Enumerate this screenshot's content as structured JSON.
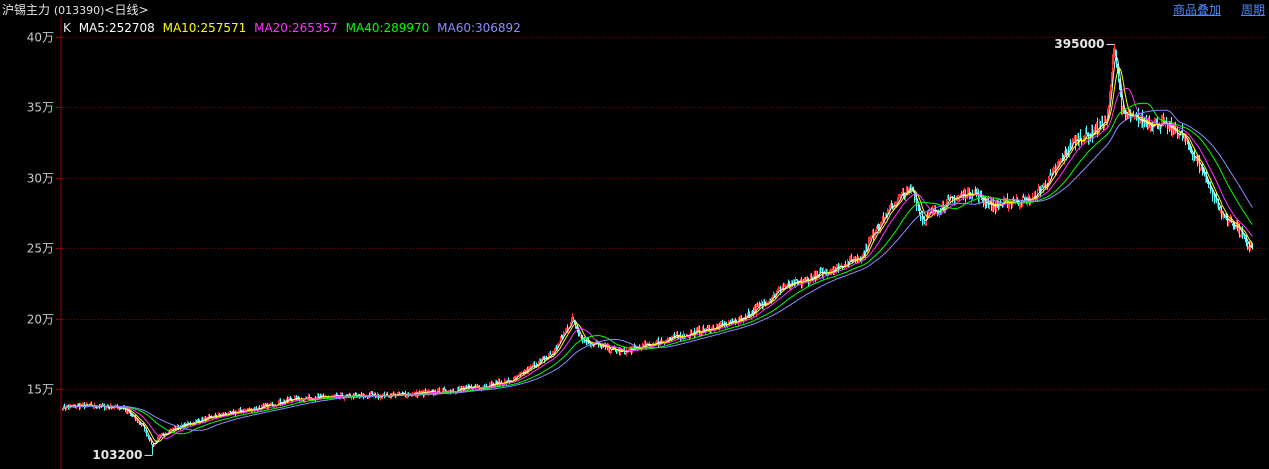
{
  "header": {
    "title": "沪锡主力",
    "code": "(013390)",
    "period": "<日线>",
    "links": [
      "商品叠加",
      "周期"
    ]
  },
  "legend": {
    "k_label": "K",
    "items": [
      {
        "label": "MA5:252708",
        "color": "#ffffff"
      },
      {
        "label": "MA10:257571",
        "color": "#ffff00"
      },
      {
        "label": "MA20:265357",
        "color": "#ff33ff"
      },
      {
        "label": "MA40:289970",
        "color": "#00ff00"
      },
      {
        "label": "MA60:306892",
        "color": "#8c8cff"
      }
    ]
  },
  "annotations": {
    "high_label": "395000",
    "low_label": "103200"
  },
  "colors": {
    "up": "#ff3232",
    "down": "#54ffff",
    "grid": "#8c0000",
    "axis": "#a00000",
    "tick": "#c8c8c8",
    "ma5": "#ffffff",
    "ma10": "#ffff00",
    "ma20": "#ff33ff",
    "ma40": "#00ff00",
    "ma60": "#8c8cff"
  },
  "chart_data": {
    "type": "candlestick",
    "title": "沪锡主力 (013390)<日线>",
    "ylim": [
      90000,
      410000
    ],
    "y_ticks": [
      150000,
      200000,
      250000,
      300000,
      350000,
      400000
    ],
    "y_tick_labels": [
      "15万",
      "20万",
      "25万",
      "30万",
      "35万",
      "40万"
    ],
    "grid": true,
    "extremes": {
      "high": 395000,
      "low": 103200
    },
    "close_path": [
      [
        0,
        137000
      ],
      [
        20,
        138000
      ],
      [
        60,
        137000
      ],
      [
        80,
        124000
      ],
      [
        90,
        110000
      ],
      [
        100,
        118000
      ],
      [
        120,
        124000
      ],
      [
        150,
        130000
      ],
      [
        200,
        137000
      ],
      [
        230,
        143000
      ],
      [
        260,
        144000
      ],
      [
        300,
        145000
      ],
      [
        340,
        146000
      ],
      [
        380,
        148000
      ],
      [
        420,
        152000
      ],
      [
        450,
        156000
      ],
      [
        470,
        166000
      ],
      [
        490,
        175000
      ],
      [
        510,
        200000
      ],
      [
        520,
        185000
      ],
      [
        540,
        180000
      ],
      [
        560,
        176000
      ],
      [
        590,
        182000
      ],
      [
        620,
        188000
      ],
      [
        650,
        193000
      ],
      [
        680,
        200000
      ],
      [
        700,
        210000
      ],
      [
        720,
        222000
      ],
      [
        740,
        226000
      ],
      [
        760,
        232000
      ],
      [
        780,
        238000
      ],
      [
        800,
        245000
      ],
      [
        810,
        260000
      ],
      [
        830,
        280000
      ],
      [
        840,
        288000
      ],
      [
        850,
        292000
      ],
      [
        860,
        270000
      ],
      [
        875,
        278000
      ],
      [
        890,
        285000
      ],
      [
        910,
        290000
      ],
      [
        930,
        280000
      ],
      [
        950,
        283000
      ],
      [
        970,
        285000
      ],
      [
        990,
        302000
      ],
      [
        1010,
        325000
      ],
      [
        1030,
        332000
      ],
      [
        1045,
        342000
      ],
      [
        1052,
        395000
      ],
      [
        1060,
        345000
      ],
      [
        1080,
        340000
      ],
      [
        1100,
        338000
      ],
      [
        1120,
        330000
      ],
      [
        1140,
        305000
      ],
      [
        1160,
        273000
      ],
      [
        1175,
        265000
      ],
      [
        1185,
        252000
      ],
      [
        1190,
        250000
      ]
    ],
    "series": [
      {
        "name": "MA5",
        "last": 252708
      },
      {
        "name": "MA10",
        "last": 257571
      },
      {
        "name": "MA20",
        "last": 265357
      },
      {
        "name": "MA40",
        "last": 289970
      },
      {
        "name": "MA60",
        "last": 306892
      }
    ]
  }
}
